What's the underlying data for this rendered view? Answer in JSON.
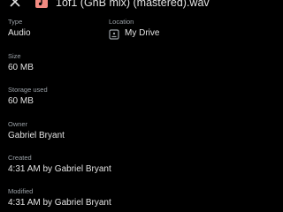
{
  "header": {
    "title": "1of1 (GnB mix) (mastered).wav",
    "close_icon": "close-icon",
    "file_icon": "audio-file-icon",
    "file_icon_color": "#f28b82"
  },
  "details": {
    "type": {
      "label": "Type",
      "value": "Audio"
    },
    "location": {
      "label": "Location",
      "value": "My Drive",
      "icon": "drive-icon"
    },
    "size": {
      "label": "Size",
      "value": "60 MB"
    },
    "storage_used": {
      "label": "Storage used",
      "value": "60 MB"
    },
    "owner": {
      "label": "Owner",
      "value": "Gabriel Bryant"
    },
    "created": {
      "label": "Created",
      "value": "4:31 AM by Gabriel Bryant"
    },
    "modified": {
      "label": "Modified",
      "value": "4:31 AM by Gabriel Bryant"
    }
  },
  "colors": {
    "background": "#000000",
    "text_primary": "#e3e3e3",
    "text_secondary": "#9aa0a6"
  }
}
